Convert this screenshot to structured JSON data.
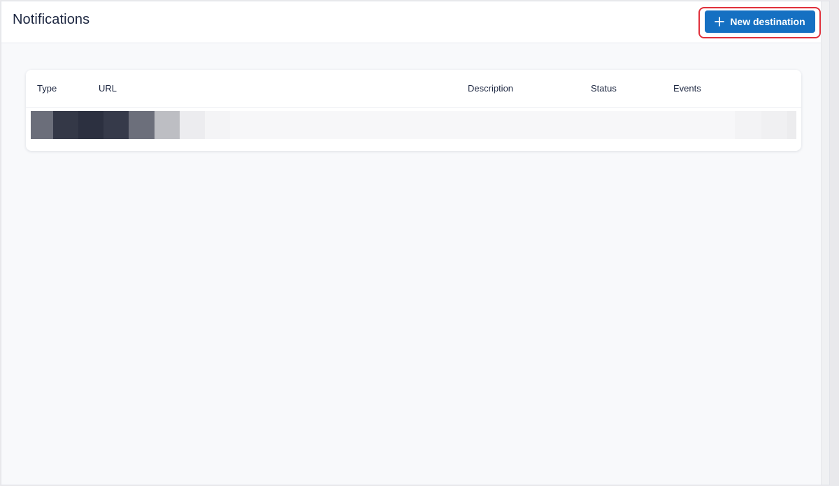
{
  "header": {
    "title": "Notifications",
    "new_button_label": "New destination",
    "new_button_icon": "plus-icon",
    "accent_color": "#1570c2",
    "highlight_color": "#e0303b"
  },
  "table": {
    "columns": [
      "Type",
      "URL",
      "Description",
      "Status",
      "Events"
    ],
    "rows_state": "loading"
  }
}
